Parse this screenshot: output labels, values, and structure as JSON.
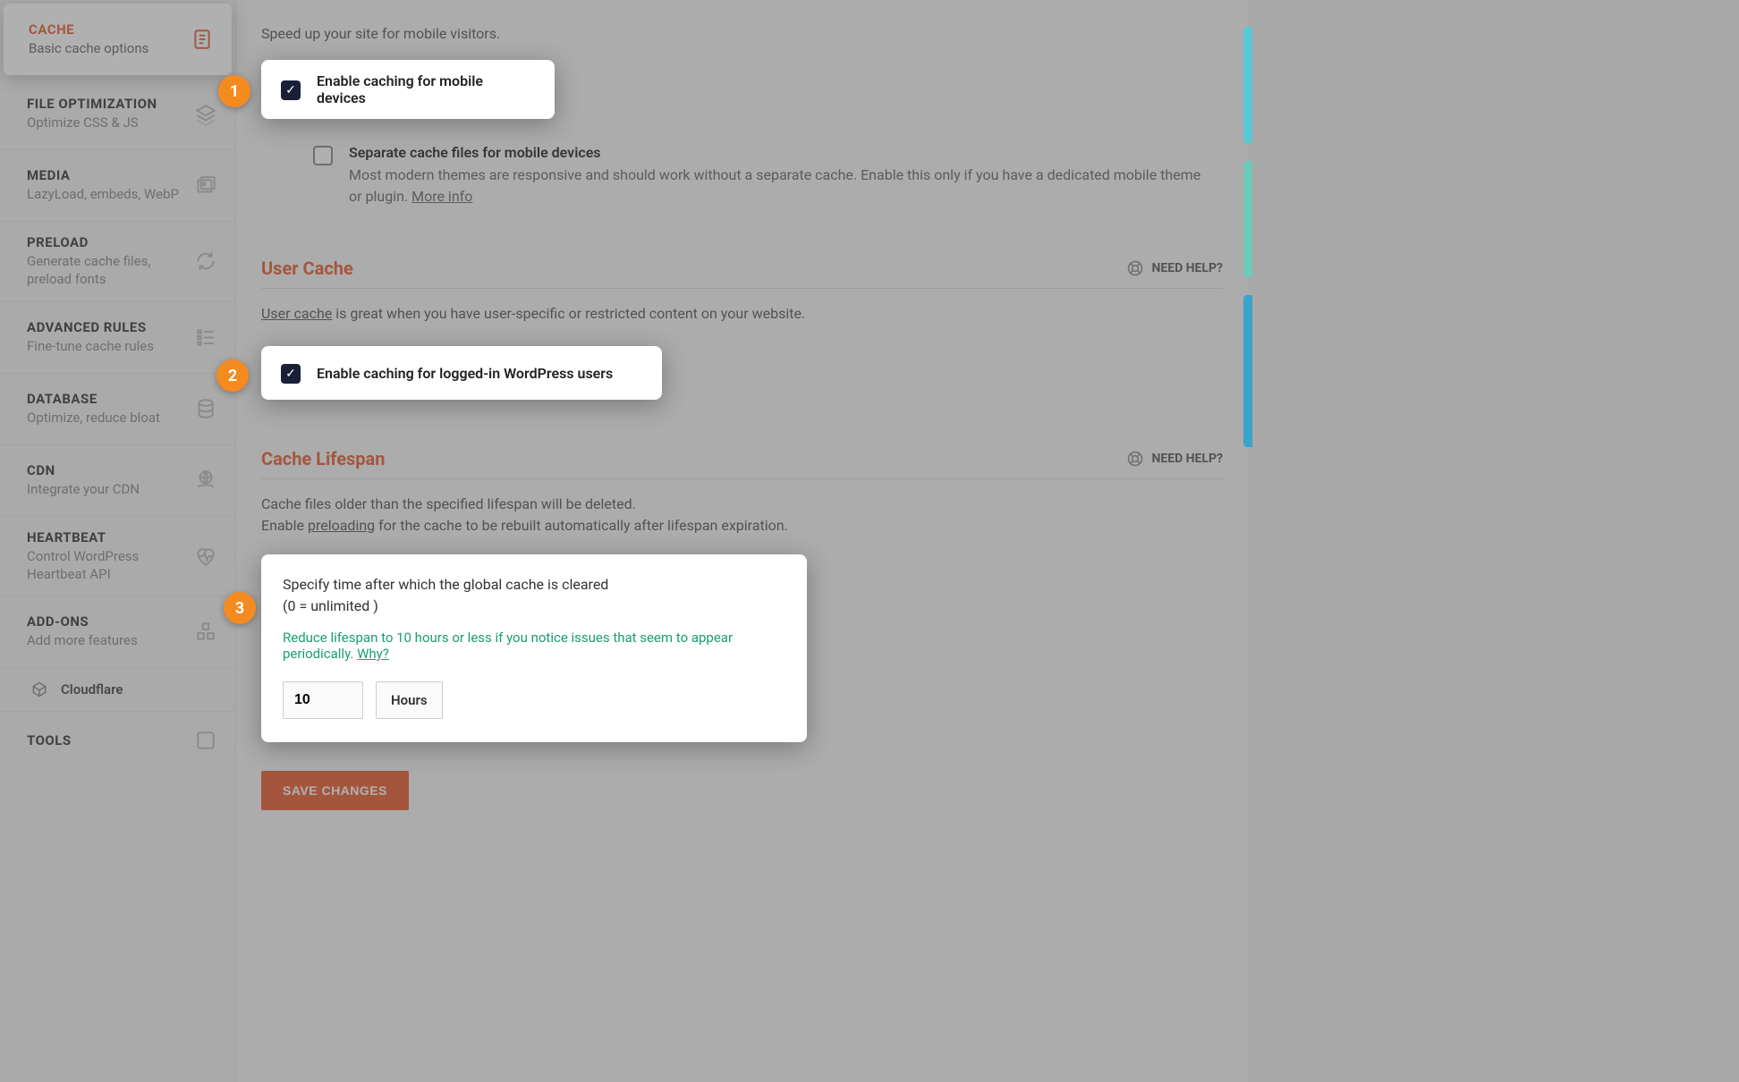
{
  "sidebar": {
    "items": [
      {
        "title": "CACHE",
        "subtitle": "Basic cache options"
      },
      {
        "title": "FILE OPTIMIZATION",
        "subtitle": "Optimize CSS & JS"
      },
      {
        "title": "MEDIA",
        "subtitle": "LazyLoad, embeds, WebP"
      },
      {
        "title": "PRELOAD",
        "subtitle": "Generate cache files, preload fonts"
      },
      {
        "title": "ADVANCED RULES",
        "subtitle": "Fine-tune cache rules"
      },
      {
        "title": "DATABASE",
        "subtitle": "Optimize, reduce bloat"
      },
      {
        "title": "CDN",
        "subtitle": "Integrate your CDN"
      },
      {
        "title": "HEARTBEAT",
        "subtitle": "Control WordPress Heartbeat API"
      },
      {
        "title": "ADD-ONS",
        "subtitle": "Add more features"
      }
    ],
    "cloudflare": "Cloudflare",
    "tools": "TOOLS"
  },
  "mobile": {
    "intro": "Speed up your site for mobile visitors.",
    "enable_label": "Enable caching for mobile devices",
    "separate_label": "Separate cache files for mobile devices",
    "separate_desc": "Most modern themes are responsive and should work without a separate cache. Enable this only if you have a dedicated mobile theme or plugin. ",
    "more_info": "More info"
  },
  "user_cache": {
    "title": "User Cache",
    "need_help": "NEED HELP?",
    "link": "User cache",
    "desc_rest": " is great when you have user-specific or restricted content on your website.",
    "enable_label": "Enable caching for logged-in WordPress users"
  },
  "lifespan": {
    "title": "Cache Lifespan",
    "need_help": "NEED HELP?",
    "desc1": "Cache files older than the specified lifespan will be deleted.",
    "desc2a": "Enable ",
    "desc2_link": "preloading",
    "desc2b": " for the cache to be rebuilt automatically after lifespan expiration.",
    "card_label1": "Specify time after which the global cache is cleared",
    "card_label2": "(0 = unlimited )",
    "hint": "Reduce lifespan to 10 hours or less if you notice issues that seem to appear periodically. ",
    "hint_link": "Why?",
    "value": "10",
    "unit": "Hours"
  },
  "save": "SAVE CHANGES",
  "callouts": {
    "c1": "1",
    "c2": "2",
    "c3": "3"
  }
}
